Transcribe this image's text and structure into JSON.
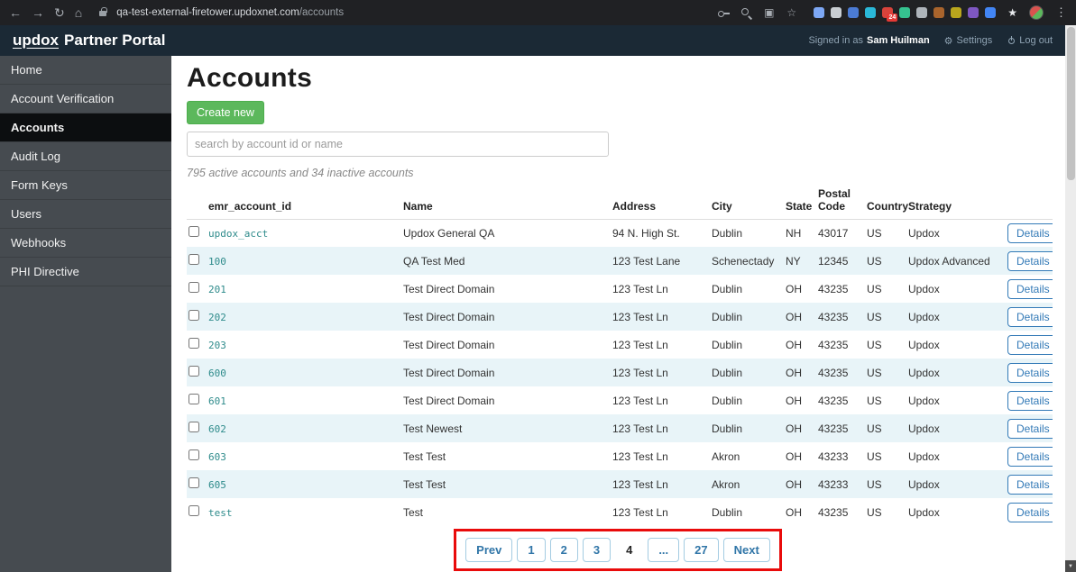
{
  "colors": {
    "accent_green": "#5cb85c",
    "link_blue": "#337ab7",
    "account_id_teal": "#2e8b8b",
    "row_stripe": "#e8f4f8",
    "header_navy": "#1b2935",
    "sidebar_gray": "#464b50",
    "annotation_red": "#e90b0b"
  },
  "browser": {
    "back_icon": "←",
    "forward_icon": "→",
    "reload_icon": "↻",
    "home_icon": "⌂",
    "url_domain": "qa-test-external-firetower.updoxnet.com",
    "url_path": "/accounts",
    "toolbar_icons": [
      {
        "name": "key-icon",
        "glyph": ""
      },
      {
        "name": "zoom-icon",
        "glyph": ""
      },
      {
        "name": "screenshot-icon",
        "glyph": "▣"
      },
      {
        "name": "star-icon",
        "glyph": "☆"
      }
    ],
    "extensions": [
      {
        "name": "extension-icon",
        "color": "#7da7f4"
      },
      {
        "name": "extension-icon",
        "color": "#c9ced3"
      },
      {
        "name": "extension-icon",
        "color": "#4b7bd4"
      },
      {
        "name": "extension-icon",
        "color": "#2ab8d8"
      },
      {
        "name": "extension-icon",
        "color": "#d8433b",
        "badge": "24"
      },
      {
        "name": "extension-icon",
        "color": "#35c28f"
      },
      {
        "name": "extension-icon",
        "color": "#aeb4ba"
      },
      {
        "name": "extension-icon",
        "color": "#a9642c"
      },
      {
        "name": "extension-icon",
        "color": "#b9a61d"
      },
      {
        "name": "extension-icon",
        "color": "#7e57c2"
      },
      {
        "name": "extension-icon",
        "color": "#4285f4"
      }
    ],
    "bookmark_star": "★",
    "menu_icon": "⋮"
  },
  "header": {
    "brand_primary": "updox",
    "brand_secondary": "Partner Portal",
    "signed_in_prefix": "Signed in as",
    "user_name": "Sam Huilman",
    "settings_icon": "⚙",
    "settings_label": "Settings",
    "logout_label": "Log out"
  },
  "sidebar": {
    "items": [
      {
        "name": "sidebar-item-home",
        "label": "Home"
      },
      {
        "name": "sidebar-item-account-verification",
        "label": "Account Verification"
      },
      {
        "name": "sidebar-item-accounts",
        "label": "Accounts",
        "active": true
      },
      {
        "name": "sidebar-item-audit-log",
        "label": "Audit Log"
      },
      {
        "name": "sidebar-item-form-keys",
        "label": "Form Keys"
      },
      {
        "name": "sidebar-item-users",
        "label": "Users"
      },
      {
        "name": "sidebar-item-webhooks",
        "label": "Webhooks"
      },
      {
        "name": "sidebar-item-phi-directive",
        "label": "PHI Directive"
      }
    ]
  },
  "main": {
    "title": "Accounts",
    "create_button": "Create new",
    "search_placeholder": "search by account id or name",
    "summary": "795 active accounts and 34 inactive accounts",
    "table": {
      "columns": [
        "emr_account_id",
        "Name",
        "Address",
        "City",
        "State",
        "Postal Code",
        "Country",
        "Strategy"
      ],
      "details_label": "Details",
      "rows": [
        {
          "id": "updox_acct",
          "name": "Updox General QA",
          "address": "94 N. High St.",
          "city": "Dublin",
          "state": "NH",
          "postal": "43017",
          "country": "US",
          "strategy": "Updox"
        },
        {
          "id": "100",
          "name": "QA Test Med",
          "address": "123 Test Lane",
          "city": "Schenectady",
          "state": "NY",
          "postal": "12345",
          "country": "US",
          "strategy": "Updox Advanced"
        },
        {
          "id": "201",
          "name": "Test Direct Domain",
          "address": "123 Test Ln",
          "city": "Dublin",
          "state": "OH",
          "postal": "43235",
          "country": "US",
          "strategy": "Updox"
        },
        {
          "id": "202",
          "name": "Test Direct Domain",
          "address": "123 Test Ln",
          "city": "Dublin",
          "state": "OH",
          "postal": "43235",
          "country": "US",
          "strategy": "Updox"
        },
        {
          "id": "203",
          "name": "Test Direct Domain",
          "address": "123 Test Ln",
          "city": "Dublin",
          "state": "OH",
          "postal": "43235",
          "country": "US",
          "strategy": "Updox"
        },
        {
          "id": "600",
          "name": "Test Direct Domain",
          "address": "123 Test Ln",
          "city": "Dublin",
          "state": "OH",
          "postal": "43235",
          "country": "US",
          "strategy": "Updox"
        },
        {
          "id": "601",
          "name": "Test Direct Domain",
          "address": "123 Test Ln",
          "city": "Dublin",
          "state": "OH",
          "postal": "43235",
          "country": "US",
          "strategy": "Updox"
        },
        {
          "id": "602",
          "name": "Test Newest",
          "address": "123 Test Ln",
          "city": "Dublin",
          "state": "OH",
          "postal": "43235",
          "country": "US",
          "strategy": "Updox"
        },
        {
          "id": "603",
          "name": "Test Test",
          "address": "123 Test Ln",
          "city": "Akron",
          "state": "OH",
          "postal": "43233",
          "country": "US",
          "strategy": "Updox"
        },
        {
          "id": "605",
          "name": "Test Test",
          "address": "123 Test Ln",
          "city": "Akron",
          "state": "OH",
          "postal": "43233",
          "country": "US",
          "strategy": "Updox"
        },
        {
          "id": "test",
          "name": "Test",
          "address": "123 Test Ln",
          "city": "Dublin",
          "state": "OH",
          "postal": "43235",
          "country": "US",
          "strategy": "Updox"
        }
      ]
    },
    "pagination": {
      "items": [
        {
          "name": "pagination-prev",
          "label": "Prev"
        },
        {
          "name": "pagination-page-1",
          "label": "1"
        },
        {
          "name": "pagination-page-2",
          "label": "2"
        },
        {
          "name": "pagination-page-3",
          "label": "3"
        },
        {
          "name": "pagination-page-4",
          "label": "4",
          "active": true
        },
        {
          "name": "pagination-ellipsis",
          "label": "..."
        },
        {
          "name": "pagination-page-27",
          "label": "27"
        },
        {
          "name": "pagination-next",
          "label": "Next"
        }
      ]
    }
  },
  "scrollbar": {
    "down_glyph": "▼"
  }
}
